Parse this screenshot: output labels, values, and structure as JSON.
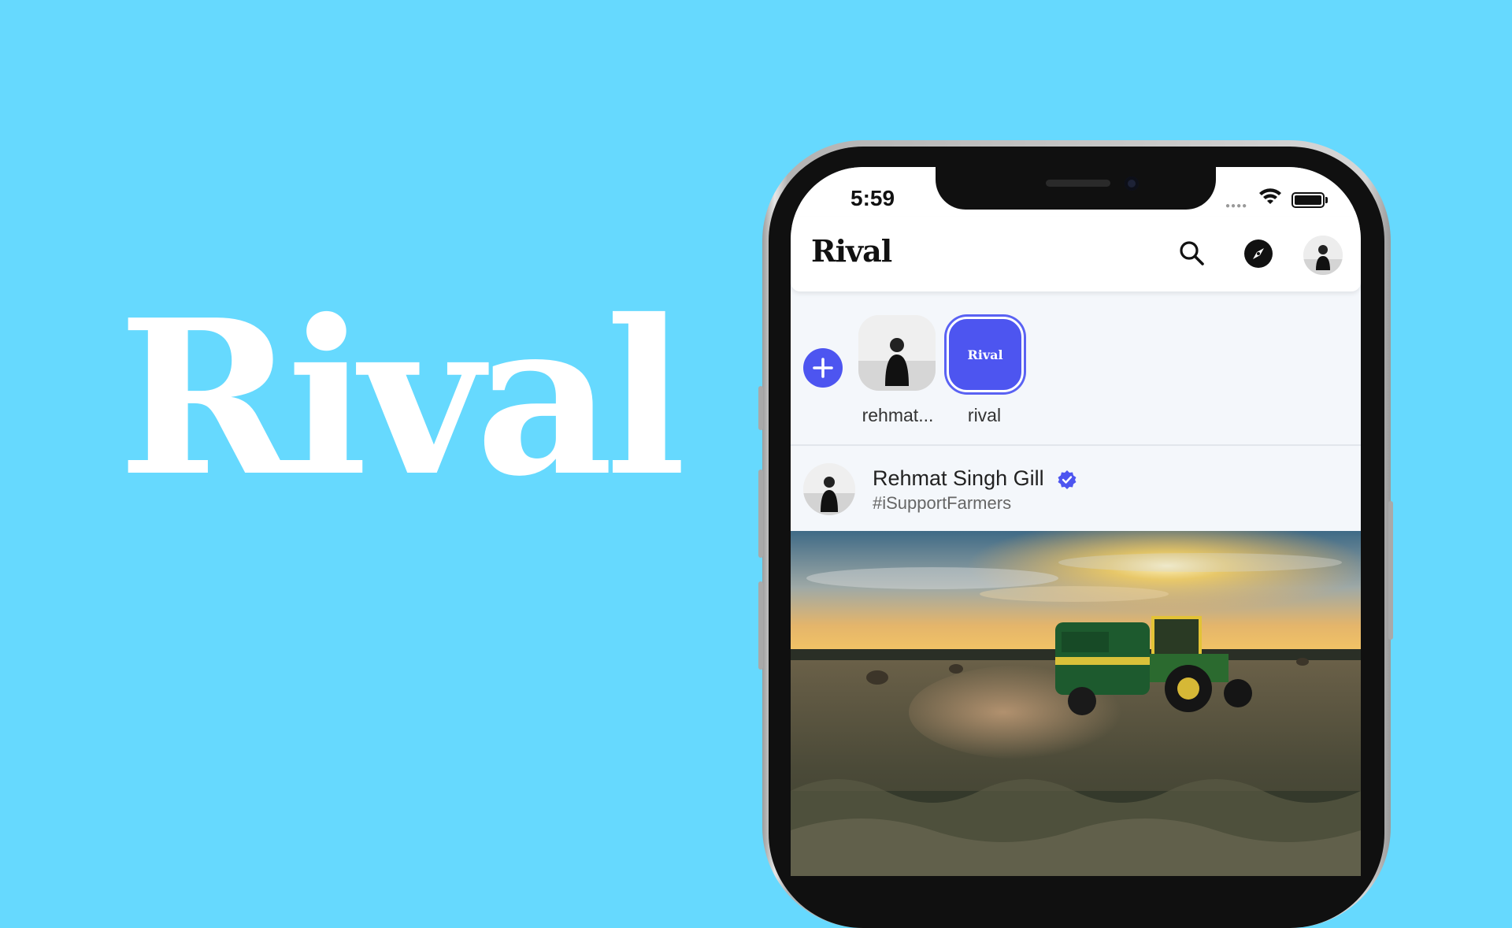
{
  "brand": {
    "wordmark": "Rival"
  },
  "colors": {
    "background": "#66D9FE",
    "accent": "#4D55F0",
    "verified": "#4D55F0"
  },
  "status_bar": {
    "time": "5:59"
  },
  "header": {
    "title": "Rival",
    "icons": [
      "search-icon",
      "compass-icon",
      "profile-avatar"
    ]
  },
  "stories": {
    "add_icon": "plus-icon",
    "items": [
      {
        "label": "rehmat...",
        "active": false
      },
      {
        "label": "rival",
        "active": true,
        "thumb_text": "Rival"
      }
    ]
  },
  "post": {
    "author": "Rehmat Singh Gill",
    "verified": true,
    "subtitle": "#iSupportFarmers"
  }
}
